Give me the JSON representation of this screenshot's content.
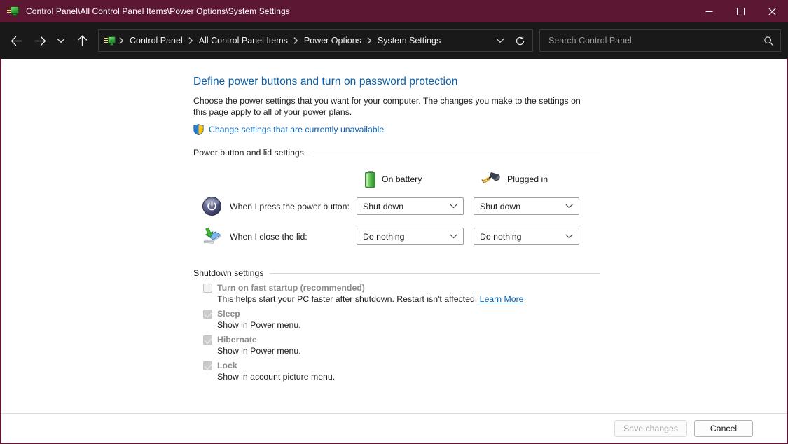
{
  "window": {
    "title": "Control Panel\\All Control Panel Items\\Power Options\\System Settings",
    "app_icon": "control-panel-icon",
    "controls": {
      "minimize": "Minimize",
      "maximize": "Maximize",
      "close": "Close"
    },
    "titlebar_color": "#5c1732",
    "navbar_color": "#191919"
  },
  "nav": {
    "back": "Back",
    "forward": "Forward",
    "recent": "Recent locations",
    "up": "Up one level",
    "breadcrumbs": [
      {
        "label": "Control Panel"
      },
      {
        "label": "All Control Panel Items"
      },
      {
        "label": "Power Options"
      },
      {
        "label": "System Settings"
      }
    ],
    "previous_locations": "Previous locations",
    "refresh": "Refresh"
  },
  "search": {
    "placeholder": "Search Control Panel",
    "value": "",
    "icon": "search-icon"
  },
  "page": {
    "heading": "Define power buttons and turn on password protection",
    "description": "Choose the power settings that you want for your computer. The changes you make to the settings on this page apply to all of your power plans.",
    "uac_link": "Change settings that are currently unavailable",
    "uac_icon": "uac-shield-icon",
    "link_color": "#0a62b5",
    "heading_color": "#0a5fa8"
  },
  "power_lid_section": {
    "title": "Power button and lid settings",
    "columns": [
      {
        "label": "On battery",
        "icon": "battery-icon"
      },
      {
        "label": "Plugged in",
        "icon": "power-plug-icon"
      }
    ],
    "rows": [
      {
        "icon": "power-button-icon",
        "label": "When I press the power button:",
        "on_battery": "Shut down",
        "plugged_in": "Shut down"
      },
      {
        "icon": "laptop-lid-icon",
        "label": "When I close the lid:",
        "on_battery": "Do nothing",
        "plugged_in": "Do nothing"
      }
    ]
  },
  "shutdown_section": {
    "title": "Shutdown settings",
    "items": [
      {
        "label": "Turn on fast startup (recommended)",
        "checked": false,
        "description": "This helps start your PC faster after shutdown. Restart isn't affected.",
        "link": "Learn More"
      },
      {
        "label": "Sleep",
        "checked": true,
        "description": "Show in Power menu.",
        "link": ""
      },
      {
        "label": "Hibernate",
        "checked": true,
        "description": "Show in Power menu.",
        "link": ""
      },
      {
        "label": "Lock",
        "checked": true,
        "description": "Show in account picture menu.",
        "link": ""
      }
    ]
  },
  "footer": {
    "save_label": "Save changes",
    "save_disabled": true,
    "cancel_label": "Cancel"
  }
}
